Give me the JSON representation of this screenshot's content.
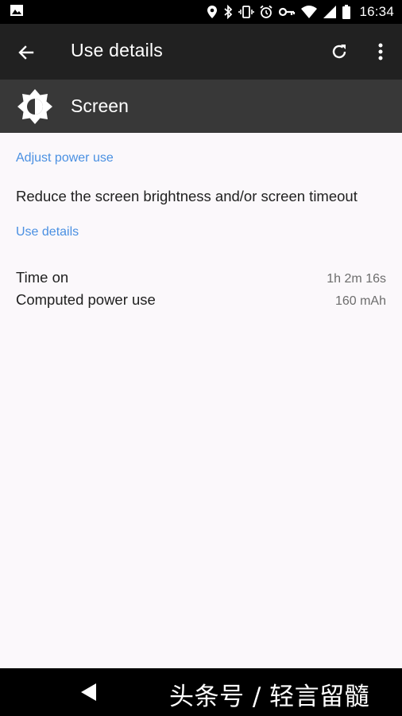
{
  "status_bar": {
    "time": "16:34",
    "icons": [
      "image-notification-icon",
      "location-icon",
      "bluetooth-icon",
      "vibrate-icon",
      "alarm-icon",
      "vpn-key-icon",
      "wifi-icon",
      "signal-icon",
      "battery-icon"
    ]
  },
  "toolbar": {
    "title": "Use details",
    "back_icon": "arrow-back-icon",
    "refresh_icon": "refresh-icon",
    "more_icon": "more-vertical-icon"
  },
  "app_header": {
    "name": "Screen",
    "icon": "brightness-icon"
  },
  "adjust_section": {
    "title": "Adjust power use",
    "tip": "Reduce the screen brightness and/or screen timeout"
  },
  "details_section": {
    "title": "Use details",
    "rows": [
      {
        "label": "Time on",
        "value": "1h 2m 16s"
      },
      {
        "label": "Computed power use",
        "value": "160 mAh"
      }
    ]
  },
  "nav_bar": {
    "back_icon": "nav-back-triangle-icon",
    "watermark": "头条号 / 轻言留髓"
  },
  "colors": {
    "accent": "#4A90E2",
    "toolbar": "#212121",
    "header": "#383838",
    "background": "#FBF8FB"
  }
}
